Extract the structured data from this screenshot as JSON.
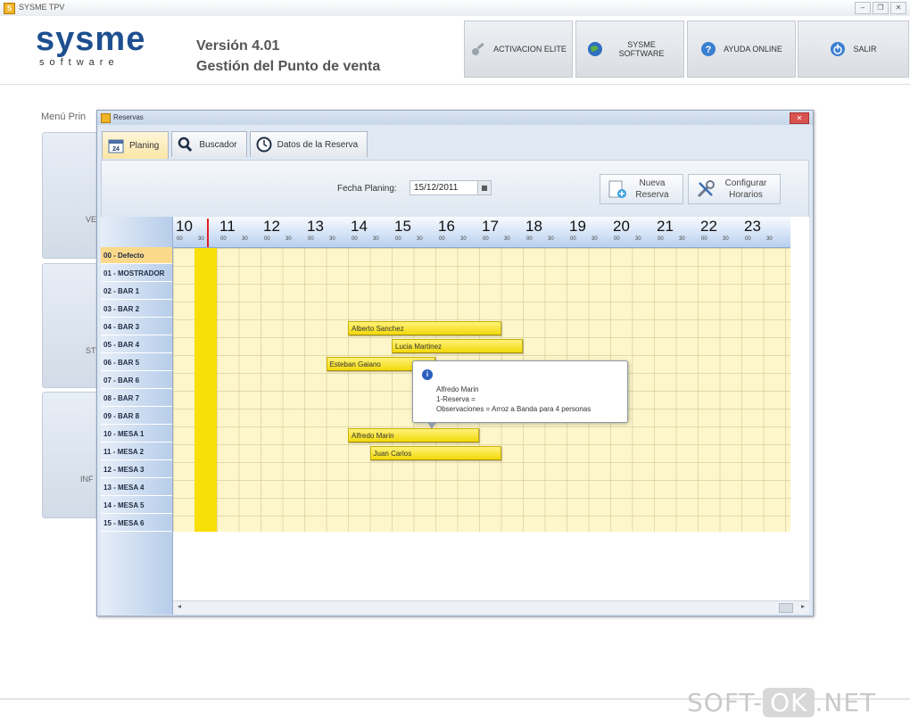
{
  "window": {
    "title": "SYSME TPV",
    "controls": [
      "–",
      "❐",
      "✕"
    ]
  },
  "brand": {
    "name": "sysme",
    "tagline": "software"
  },
  "header": {
    "version": "Versión 4.01",
    "subtitle": "Gestión del Punto de venta"
  },
  "top_buttons": [
    {
      "label": "ACTIVACION ELITE",
      "icon": "key-icon"
    },
    {
      "label": "SYSME SOFTWARE",
      "icon": "globe-icon"
    },
    {
      "label": "AYUDA ONLINE",
      "icon": "help-icon"
    },
    {
      "label": "SALIR",
      "icon": "power-icon"
    }
  ],
  "left_menu": {
    "title": "Menú Prin",
    "tiles": [
      "VE",
      "ST",
      "INF"
    ]
  },
  "dialog": {
    "title": "Reservas",
    "tabs": [
      {
        "label": "Planing",
        "icon": "calendar-icon",
        "badge": "24"
      },
      {
        "label": "Buscador",
        "icon": "magnifier-icon"
      },
      {
        "label": "Datos de la Reserva",
        "icon": "clock-icon"
      }
    ],
    "fecha_label": "Fecha Planing:",
    "fecha_value": "15/12/2011",
    "nueva_reserva": "Nueva Reserva",
    "configurar_horarios": "Configurar Horarios",
    "hours": [
      "10",
      "11",
      "12",
      "13",
      "14",
      "15",
      "16",
      "17",
      "18",
      "19",
      "20",
      "21",
      "22",
      "23"
    ],
    "minute_marks": [
      "00",
      "30"
    ],
    "rows": [
      "00 - Defecto",
      "01 - MOSTRADOR",
      "02 - BAR 1",
      "03 - BAR 2",
      "04 - BAR 3",
      "05 - BAR 4",
      "06 - BAR 5",
      "07 - BAR 6",
      "08 - BAR 7",
      "09 - BAR 8",
      "10 - MESA 1",
      "11 - MESA 2",
      "12 - MESA 3",
      "13 - MESA 4",
      "14 - MESA 5",
      "15 - MESA 6"
    ],
    "reservations": [
      {
        "name": "Alberto Sanchez",
        "row": 4,
        "start_hour": 14.0,
        "end_hour": 17.5
      },
      {
        "name": "Lucia Martinez",
        "row": 5,
        "start_hour": 15.0,
        "end_hour": 18.0
      },
      {
        "name": "Esteban Gaiano",
        "row": 6,
        "start_hour": 13.5,
        "end_hour": 16.0
      },
      {
        "name": "Alfredo Marin",
        "row": 10,
        "start_hour": 14.0,
        "end_hour": 17.0
      },
      {
        "name": "Juan Carlos",
        "row": 11,
        "start_hour": 14.5,
        "end_hour": 17.5
      }
    ],
    "tooltip": {
      "name": "Alfredo Marin",
      "line2": "1-Reserva =",
      "line3": "Observaciones = Arroz a Banda para 4 personas"
    }
  },
  "watermark": {
    "left": "SOFT-",
    "middle": "OK",
    "right": ".NET"
  }
}
